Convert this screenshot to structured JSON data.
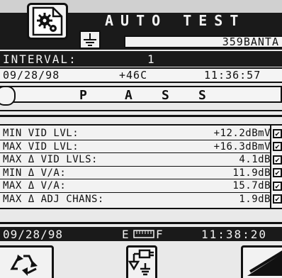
{
  "header": {
    "title": "AUTO TEST",
    "settings_icon": "gear-document-icon",
    "ground_icon": "ground-icon",
    "station_id": "359BANTA"
  },
  "interval": {
    "label": "INTERVAL:",
    "value": "1"
  },
  "test_info": {
    "date": "09/28/98",
    "temperature": "+46C",
    "time": "11:36:57"
  },
  "result": {
    "letters": [
      "P",
      "A",
      "S",
      "S"
    ],
    "status": "PASS"
  },
  "measurements": [
    {
      "label": "MIN VID LVL:",
      "value": "+12.2dBmV",
      "checked": true
    },
    {
      "label": "MAX VID LVL:",
      "value": "+16.3dBmV",
      "checked": true
    },
    {
      "label": "MAX Δ VID LVLS:",
      "value": "4.1dB",
      "checked": true
    },
    {
      "label": "MIN Δ V/A:",
      "value": "11.9dB",
      "checked": true
    },
    {
      "label": "MAX Δ V/A:",
      "value": "15.7dB",
      "checked": true
    },
    {
      "label": "MAX Δ ADJ CHANS:",
      "value": "1.9dB",
      "checked": true
    }
  ],
  "status_bar": {
    "date": "09/28/98",
    "battery_empty": "E",
    "battery_full": "F",
    "battery_icon": "battery-gauge-icon",
    "time": "11:38:20"
  },
  "softkeys": [
    {
      "icon": "recycle-icon"
    },
    {
      "icon": "plug-ground-icon"
    },
    {
      "icon": "signal-ramp-icon"
    }
  ],
  "colors": {
    "background": "#e9e9e9",
    "foreground": "#111111",
    "highlight": "#1a1a1a"
  }
}
